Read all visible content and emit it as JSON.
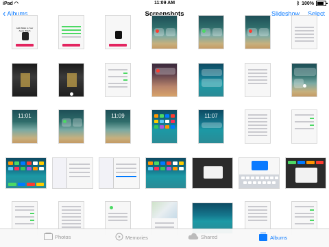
{
  "status": {
    "left": "iPad",
    "time": "11:09 AM",
    "battery": "100%"
  },
  "nav": {
    "back": "Albums",
    "title": "Screenshots",
    "slideshow": "Slideshow",
    "select": "Select"
  },
  "thumb_text": {
    "applepay_title": "Add Wallet to Your Apple Watch",
    "clock_a": "11:01",
    "clock_b": "11:09",
    "clock_c": "11:07"
  },
  "tabs": [
    {
      "label": "Photos",
      "icon": "photos-icon",
      "active": false
    },
    {
      "label": "Memories",
      "icon": "memories-icon",
      "active": false
    },
    {
      "label": "Shared",
      "icon": "shared-cloud-icon",
      "active": false
    },
    {
      "label": "Albums",
      "icon": "albums-icon",
      "active": true
    }
  ],
  "colors": {
    "accent": "#0a7aff",
    "inactive": "#999999",
    "pink": "#e3245f",
    "green": "#4cd964"
  }
}
